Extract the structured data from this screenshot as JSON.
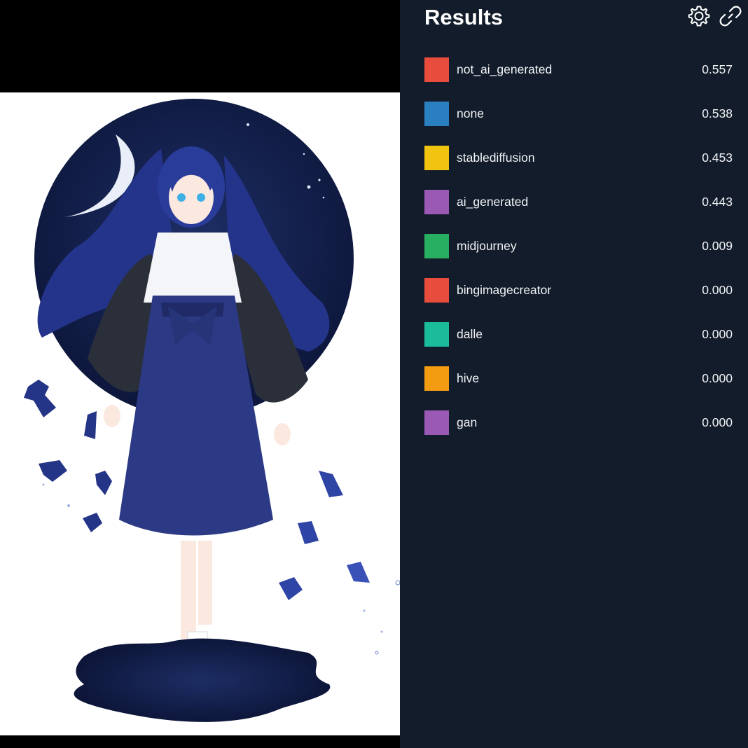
{
  "panel": {
    "title": "Results",
    "settings_icon": "gear-icon",
    "share_icon": "link-icon"
  },
  "results": [
    {
      "label": "not_ai_generated",
      "score": "0.557",
      "color": "#e74c3c"
    },
    {
      "label": "none",
      "score": "0.538",
      "color": "#2a7fc0"
    },
    {
      "label": "stablediffusion",
      "score": "0.453",
      "color": "#f1c40f"
    },
    {
      "label": "ai_generated",
      "score": "0.443",
      "color": "#9b59b6"
    },
    {
      "label": "midjourney",
      "score": "0.009",
      "color": "#27ae60"
    },
    {
      "label": "bingimagecreator",
      "score": "0.000",
      "color": "#e74c3c"
    },
    {
      "label": "dalle",
      "score": "0.000",
      "color": "#1abc9c"
    },
    {
      "label": "hive",
      "score": "0.000",
      "color": "#f39c12"
    },
    {
      "label": "gan",
      "score": "0.000",
      "color": "#9b59b6"
    }
  ]
}
